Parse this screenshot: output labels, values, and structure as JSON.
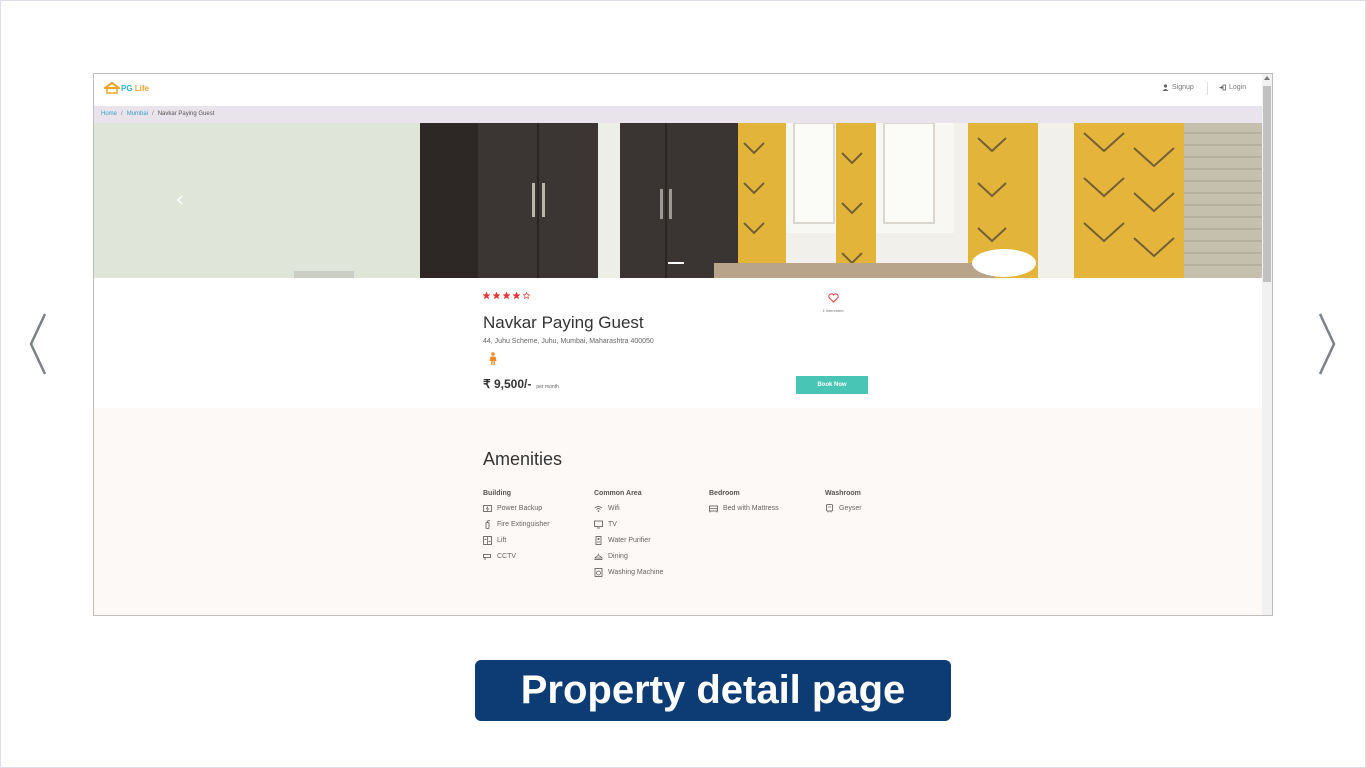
{
  "brand": {
    "logo_text_prefix": "PG",
    "logo_text_suffix": " Life",
    "color_primary": "#49c5b6",
    "color_logo_orange": "#f0a52e",
    "color_logo_teal": "#2fb6c9"
  },
  "header": {
    "signup_label": "Signup",
    "login_label": "Login"
  },
  "breadcrumb": {
    "home": "Home",
    "city": "Mumbai",
    "current": "Navkar Paying Guest",
    "separator": "/"
  },
  "property": {
    "rating": 4,
    "rating_max": 5,
    "name": "Navkar Paying Guest",
    "address": "44, Juhu Scheme, Juhu, Mumbai, Maharashtra 400050",
    "interested_text": "1 interested",
    "rent": "₹ 9,500/-",
    "rent_unit": "per month",
    "book_label": "Book Now",
    "gender_icon": "female-icon",
    "star_color": "#e53935"
  },
  "amenities": {
    "title": "Amenities",
    "groups": [
      {
        "title": "Building",
        "items": [
          {
            "icon": "power-backup-icon",
            "label": "Power Backup"
          },
          {
            "icon": "fire-extinguisher-icon",
            "label": "Fire Extinguisher"
          },
          {
            "icon": "lift-icon",
            "label": "Lift"
          },
          {
            "icon": "cctv-icon",
            "label": "CCTV"
          }
        ]
      },
      {
        "title": "Common Area",
        "items": [
          {
            "icon": "wifi-icon",
            "label": "Wifi"
          },
          {
            "icon": "tv-icon",
            "label": "TV"
          },
          {
            "icon": "water-purifier-icon",
            "label": "Water Purifier"
          },
          {
            "icon": "dining-icon",
            "label": "Dining"
          },
          {
            "icon": "washing-machine-icon",
            "label": "Washing Machine"
          }
        ]
      },
      {
        "title": "Bedroom",
        "items": [
          {
            "icon": "bed-icon",
            "label": "Bed with Mattress"
          }
        ]
      },
      {
        "title": "Washroom",
        "items": [
          {
            "icon": "geyser-icon",
            "label": "Geyser"
          }
        ]
      }
    ]
  },
  "caption": {
    "text": "Property detail page",
    "background": "#0d3c75"
  }
}
